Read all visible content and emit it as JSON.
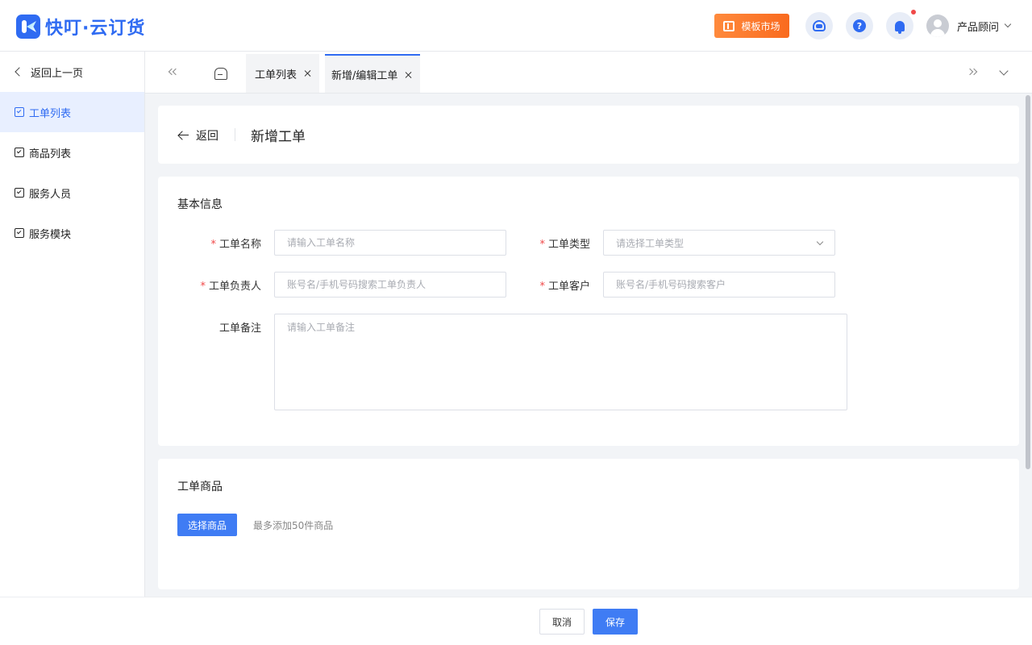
{
  "brand": {
    "name": "快叮·云订货"
  },
  "header": {
    "template_market_label": "模板市场",
    "user_name": "产品顾问"
  },
  "sidebar": {
    "back_label": "返回上一页",
    "items": [
      {
        "label": "工单列表",
        "active": true
      },
      {
        "label": "商品列表",
        "active": false
      },
      {
        "label": "服务人员",
        "active": false
      },
      {
        "label": "服务模块",
        "active": false
      }
    ]
  },
  "tabs": [
    {
      "label": "工单列表",
      "active": false
    },
    {
      "label": "新增/编辑工单",
      "active": true
    }
  ],
  "page": {
    "back_label": "返回",
    "title": "新增工单"
  },
  "basic_info": {
    "title": "基本信息",
    "name_label": "工单名称",
    "name_placeholder": "请输入工单名称",
    "type_label": "工单类型",
    "type_placeholder": "请选择工单类型",
    "owner_label": "工单负责人",
    "owner_placeholder": "账号名/手机号码搜索工单负责人",
    "customer_label": "工单客户",
    "customer_placeholder": "账号名/手机号码搜索客户",
    "remark_label": "工单备注",
    "remark_placeholder": "请输入工单备注",
    "required_mark": "*"
  },
  "goods": {
    "title": "工单商品",
    "select_button": "选择商品",
    "hint": "最多添加50件商品"
  },
  "footer": {
    "cancel_label": "取消",
    "save_label": "保存"
  },
  "colors": {
    "primary": "#2f6bf2",
    "accent_orange": "#f96a1e",
    "required": "#f04848"
  }
}
